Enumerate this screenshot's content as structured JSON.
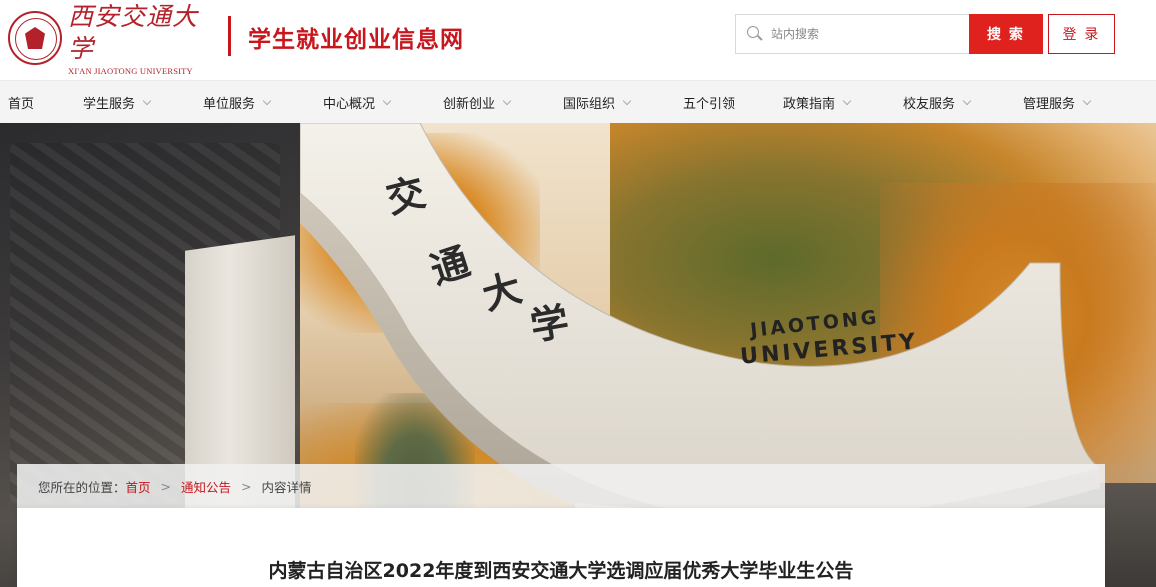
{
  "brand": {
    "logo_cn": "西安交通大学",
    "logo_en": "XI'AN JIAOTONG UNIVERSITY",
    "site_title": "学生就业创业信息网",
    "accent_color": "#c8161d"
  },
  "search": {
    "placeholder": "站内搜索",
    "button_label": "搜 索",
    "icon": "search-icon"
  },
  "login": {
    "label": "登 录"
  },
  "nav": {
    "items": [
      {
        "label": "首页",
        "has_dropdown": false
      },
      {
        "label": "学生服务",
        "has_dropdown": true
      },
      {
        "label": "单位服务",
        "has_dropdown": true
      },
      {
        "label": "中心概况",
        "has_dropdown": true
      },
      {
        "label": "创新创业",
        "has_dropdown": true
      },
      {
        "label": "国际组织",
        "has_dropdown": true
      },
      {
        "label": "五个引领",
        "has_dropdown": false
      },
      {
        "label": "政策指南",
        "has_dropdown": true
      },
      {
        "label": "校友服务",
        "has_dropdown": true
      },
      {
        "label": "管理服务",
        "has_dropdown": true
      }
    ]
  },
  "banner": {
    "arch_text_cn": [
      "交",
      "通",
      "大",
      "学"
    ],
    "arch_text_en_line1": "JIAOTONG",
    "arch_text_en_line2": "UNIVERSITY"
  },
  "breadcrumb": {
    "prefix": "您所在的位置：",
    "items": [
      "首页",
      "通知公告",
      "内容详情"
    ]
  },
  "article": {
    "title": "内蒙古自治区2022年度到西安交通大学选调应届优秀大学毕业生公告"
  }
}
